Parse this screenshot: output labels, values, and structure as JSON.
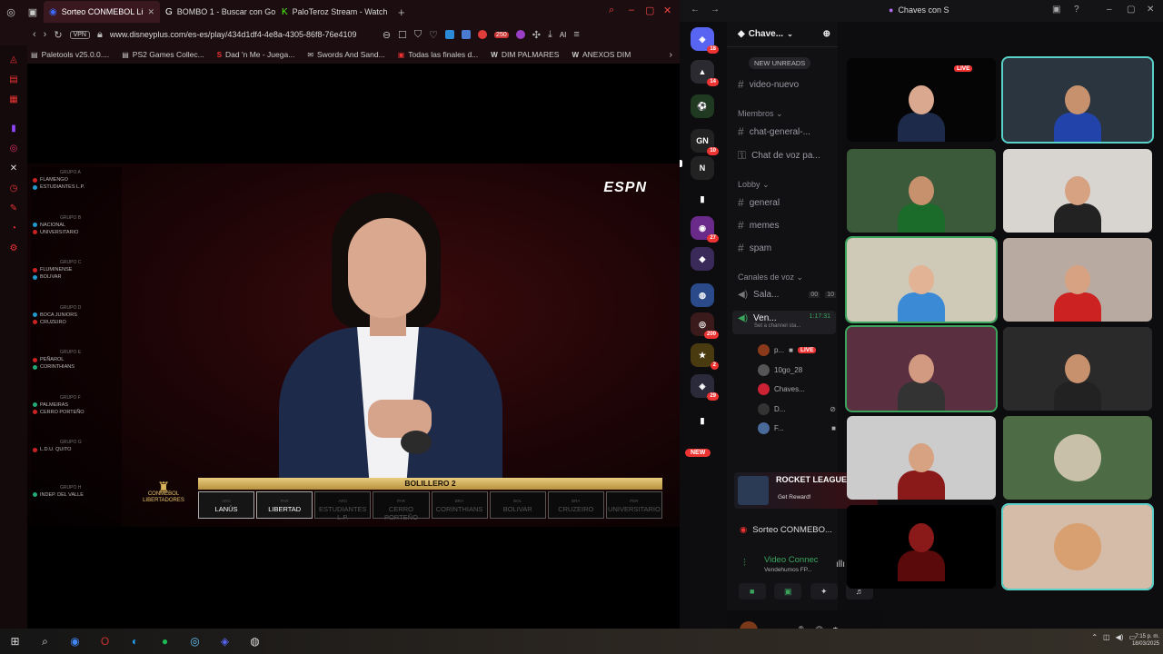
{
  "browser": {
    "tabs": [
      {
        "title": "Sorteo CONMEBOL Li",
        "icon": "disney-plus-icon",
        "active": true
      },
      {
        "title": "BOMBO 1 - Buscar con Go",
        "icon": "google-icon",
        "active": false
      },
      {
        "title": "PaloTeroz Stream - Watch",
        "icon": "kick-icon",
        "active": false
      }
    ],
    "vpn_label": "VPN",
    "url": "www.disneyplus.com/es-es/play/434d1df4-4e8a-4305-86f8-76e4109",
    "ext_badge": "250",
    "ai_label": "AI",
    "bookmarks": [
      {
        "label": "Paletools v25.0.0....",
        "icon": "bookmark-icon"
      },
      {
        "label": "PS2 Games Collec...",
        "icon": "ps2-icon"
      },
      {
        "label": "Dad 'n Me - Juega...",
        "icon": "s-icon"
      },
      {
        "label": "Swords And Sand...",
        "icon": "mail-icon"
      },
      {
        "label": "Todas las finales d...",
        "icon": "trophy-icon"
      },
      {
        "label": "DIM PALMARES",
        "icon": "w-icon"
      },
      {
        "label": "ANEXOS DIM",
        "icon": "w-icon"
      }
    ]
  },
  "broadcast": {
    "network": "ESPN",
    "groups": [
      {
        "label": "GRUPO A",
        "teams": [
          "FLAMENGO",
          "ESTUDIANTES L.P."
        ]
      },
      {
        "label": "GRUPO B",
        "teams": [
          "NACIONAL",
          "UNIVERSITARIO"
        ]
      },
      {
        "label": "GRUPO C",
        "teams": [
          "FLUMINENSE",
          "BOLIVAR"
        ]
      },
      {
        "label": "GRUPO D",
        "teams": [
          "BOCA JUNIORS",
          "CRUZEIRO"
        ]
      },
      {
        "label": "GRUPO E",
        "teams": [
          "PEÑAROL",
          "CORINTHIANS"
        ]
      },
      {
        "label": "GRUPO F",
        "teams": [
          "PALMEIRAS",
          "CERRO PORTEÑO"
        ]
      },
      {
        "label": "GRUPO G",
        "teams": [
          "L.D.U. QUITO"
        ]
      },
      {
        "label": "GRUPO H",
        "teams": [
          "INDEP. DEL VALLE"
        ]
      }
    ],
    "tournament": "CONMEBOL LIBERTADORES",
    "bolillero_title": "BOLILLERO 2",
    "balls": [
      {
        "country": "ARG",
        "team": "LANÚS",
        "active": true
      },
      {
        "country": "PAR",
        "team": "LIBERTAD",
        "active": true
      },
      {
        "country": "ARG",
        "team": "ESTUDIANTES L.P.",
        "active": false
      },
      {
        "country": "PAR",
        "team": "CERRO PORTEÑO",
        "active": false
      },
      {
        "country": "BRA",
        "team": "CORINTHIANS",
        "active": false
      },
      {
        "country": "BOL",
        "team": "BOLIVAR",
        "active": false
      },
      {
        "country": "BRA",
        "team": "CRUZEIRO",
        "active": false
      },
      {
        "country": "PER",
        "team": "UNIVERSITARIO",
        "active": false
      }
    ]
  },
  "discord": {
    "window_title": "Chaves con S",
    "server_name": "Chave...",
    "server_badges": [
      "18",
      "14",
      "10",
      "27",
      "200",
      "2",
      "29"
    ],
    "new_badge": "NEW",
    "new_unreads": "NEW UNREADS",
    "channels_top": [
      "video-nuevo"
    ],
    "category_members": "Miembros",
    "channels_members": [
      "chat-general-...",
      "Chat de voz pa..."
    ],
    "category_lobby": "Lobby",
    "channels_lobby": [
      "general",
      "memes",
      "spam"
    ],
    "category_voice": "Canales de voz",
    "voice_channel_1": {
      "name": "Sala...",
      "count_a": "00",
      "count_b": "10"
    },
    "voice_channel_2": {
      "name": "Ven...",
      "time": "1:17:31",
      "status": "Set a channel sta..."
    },
    "voice_users": [
      {
        "name": "p...",
        "live": "LIVE"
      },
      {
        "name": "10go_28",
        "live": ""
      },
      {
        "name": "Chaves...",
        "live": ""
      },
      {
        "name": "D...",
        "live": ""
      },
      {
        "name": "F...",
        "live": ""
      }
    ],
    "promo": {
      "title": "ROCKET LEAGUE",
      "subtitle": "Get Reward!"
    },
    "stream_label": "Sorteo CONMEBO...",
    "voice_connected": "Video Connec",
    "voice_server": "Vendehumos FP...",
    "user": "p..."
  },
  "taskbar": {
    "clock_time": "7:15 p. m.",
    "clock_date": "18/03/2025"
  },
  "colors": {
    "browser_chrome": "#1b0d10",
    "discord_bg": "#0d0d10",
    "speaking_outline": "#3ba55d",
    "live_red": "#e33"
  }
}
